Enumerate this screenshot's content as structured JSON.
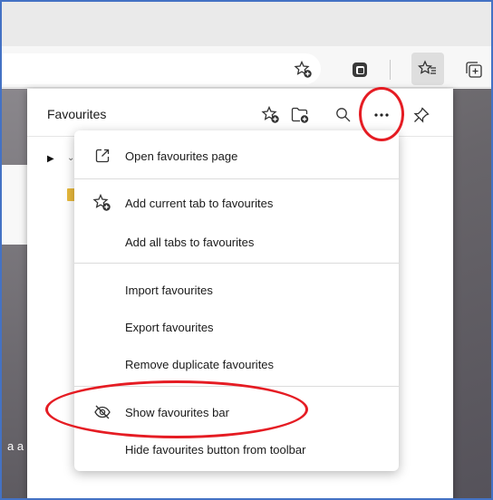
{
  "panel": {
    "title": "Favourites"
  },
  "content": {
    "left_snippet": "a a"
  },
  "menu": {
    "items": [
      {
        "label": "Open favourites page",
        "icon": "open-external-icon"
      },
      {
        "label": "Add current tab to favourites",
        "icon": "star-add-icon"
      },
      {
        "label": "Add all tabs to favourites"
      },
      {
        "label": "Import favourites"
      },
      {
        "label": "Export favourites"
      },
      {
        "label": "Remove duplicate favourites"
      },
      {
        "label": "Show favourites bar",
        "icon": "eye-slash-icon"
      },
      {
        "label": "Hide favourites button from toolbar"
      }
    ]
  },
  "annotations": {
    "highlight_color": "#e51c23"
  }
}
